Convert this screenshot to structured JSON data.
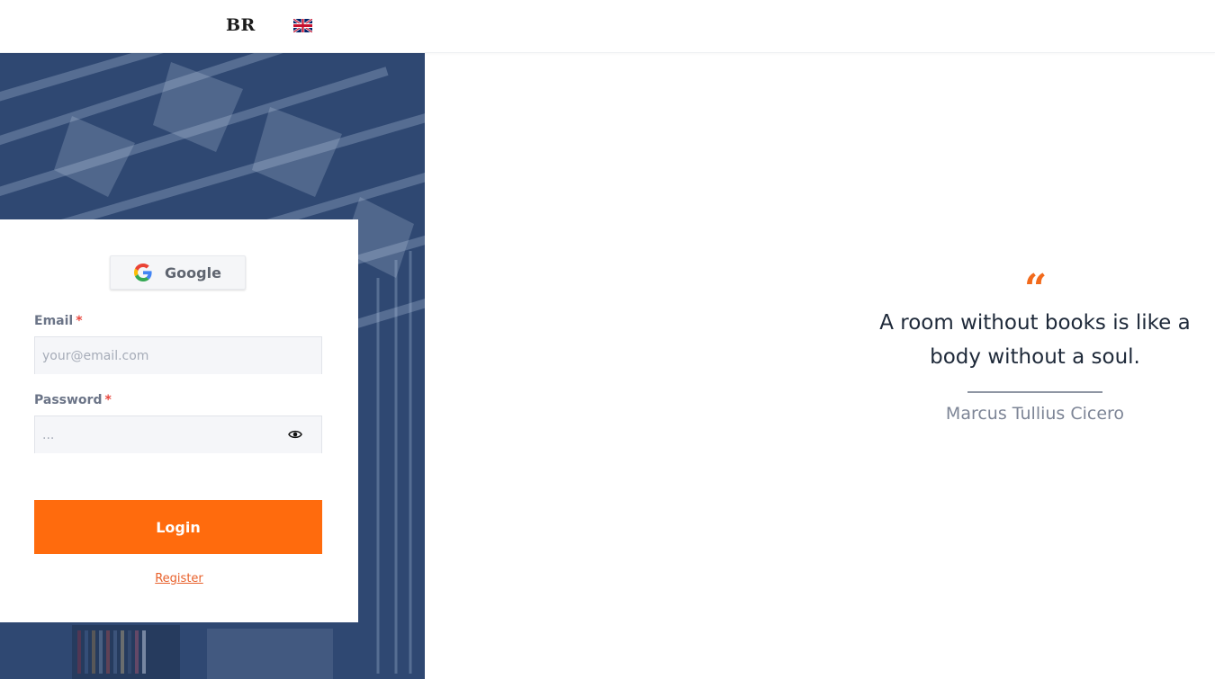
{
  "header": {
    "brand": "BR",
    "language_flag_icon": "uk-flag-icon"
  },
  "login": {
    "google_label": "Google",
    "email_label": "Email",
    "email_placeholder": "your@email.com",
    "email_value": "",
    "password_label": "Password",
    "password_placeholder": "...",
    "password_value": "",
    "required_marker": "*",
    "login_label": "Login",
    "register_label": "Register"
  },
  "quote": {
    "mark": "“",
    "text": "A room without books is like a body without a soul.",
    "author": "Marcus Tullius Cicero"
  },
  "colors": {
    "accent": "#ff6b0d",
    "hero_overlay": "#2e4771",
    "text_dark": "#1e2939",
    "text_muted": "#7d8596"
  }
}
